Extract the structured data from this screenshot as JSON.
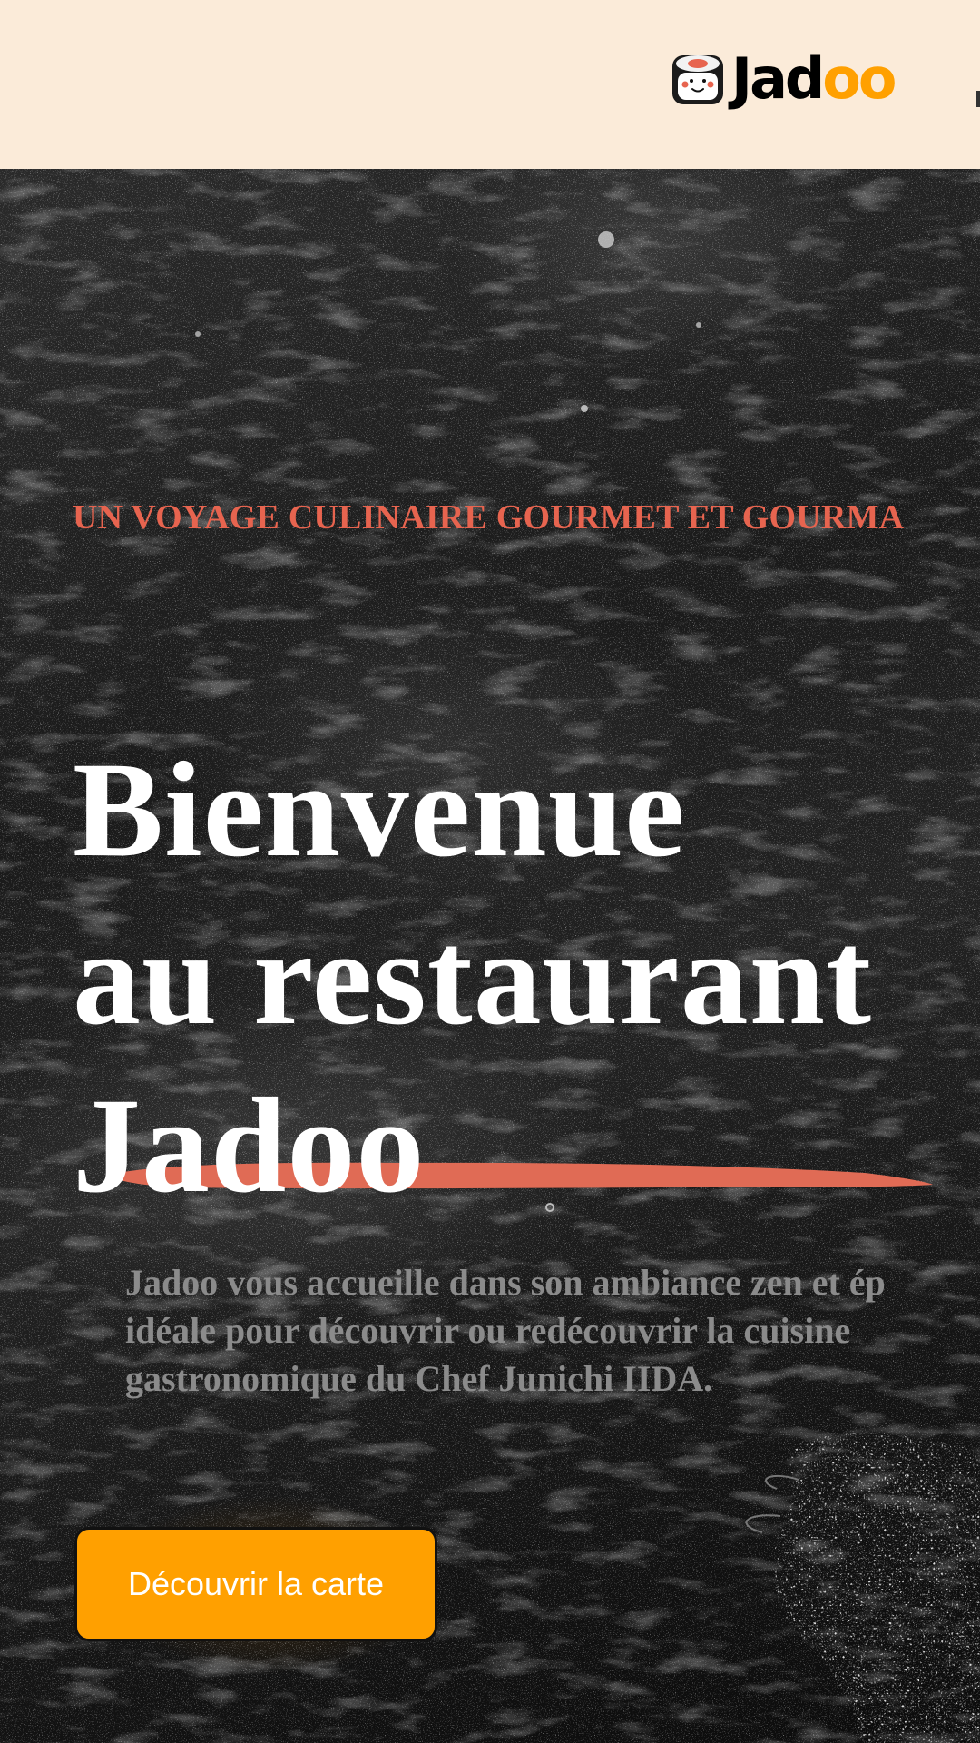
{
  "header": {
    "logo": {
      "brand_prefix": "Jad",
      "brand_suffix": "oo",
      "icon": "sushi-roll-mascot-icon"
    }
  },
  "hero": {
    "tagline": "UN VOYAGE CULINAIRE GOURMET ET GOURMA",
    "title_lines": [
      "Bienvenue",
      "au restaurant",
      "Jadoo"
    ],
    "description_lines": [
      "Jadoo vous accueille dans son ambiance zen et ép",
      "idéale pour découvrir ou redécouvrir la cuisine",
      "gastronomique du Chef Junichi IIDA."
    ],
    "cta_label": "Découvrir la carte"
  },
  "colors": {
    "header_bg": "#fbebd9",
    "accent_orange": "#ffa000",
    "accent_coral": "#e7644f",
    "hero_text": "#ffffff",
    "description_text": "#8b8b8b"
  }
}
